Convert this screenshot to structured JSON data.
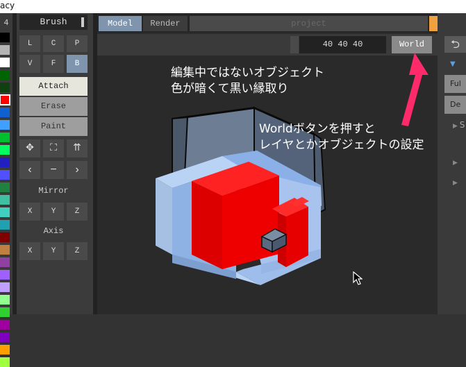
{
  "window": {
    "title": "acy"
  },
  "palette": {
    "header": "4",
    "colors": [
      "#000000",
      "#b4b4b4",
      "#ffffff",
      "#006400",
      "#104010",
      "#ff0000",
      "#1060d0",
      "#40a0ff",
      "#00c030",
      "#00ff60",
      "#2020c0",
      "#5050ff",
      "#208040",
      "#40c0a0",
      "#40d0c0",
      "#20a0b0",
      "#800000",
      "#c08040",
      "#9040a0",
      "#a060ff",
      "#c0a0ff",
      "#90ff90",
      "#30d030",
      "#a000a0",
      "#8000c0",
      "#ffa000",
      "#a0ff40"
    ]
  },
  "brush_panel": {
    "title": "Brush",
    "shape_buttons": [
      "L",
      "C",
      "P",
      "V",
      "F",
      "B"
    ],
    "modes": [
      "Attach",
      "Erase",
      "Paint"
    ],
    "transform_tools": [
      "move-icon",
      "select-rect-icon",
      "lift-icon",
      "prev-icon",
      "minus-icon",
      "next-icon"
    ],
    "transform_glyphs": [
      "✥",
      "⛶",
      "⇈",
      "‹",
      "−",
      "›"
    ],
    "mirror": {
      "label": "Mirror",
      "axes": [
        "X",
        "Y",
        "Z"
      ]
    },
    "axis": {
      "label": "Axis",
      "axes": [
        "X",
        "Y",
        "Z"
      ]
    }
  },
  "tabs": [
    "Model",
    "Render"
  ],
  "project_label": "project",
  "toolbar": {
    "dimensions": "40 40 40",
    "world_button": "World"
  },
  "annotations": {
    "top_line1": "編集中ではないオブジェクト",
    "top_line2": "色が暗くて黒い縁取り",
    "right_line1": "Worldボタンを押すと",
    "right_line2": "レイヤとかオブジェクトの設定"
  },
  "right_panel": {
    "buttons": [
      "Ful",
      "De"
    ],
    "items": [
      "S",
      "",
      ""
    ]
  },
  "colors": {
    "accent_orange": "#f0a040",
    "annotation_arrow": "#ff2a6a",
    "selected_blue": "#7e95ad"
  }
}
